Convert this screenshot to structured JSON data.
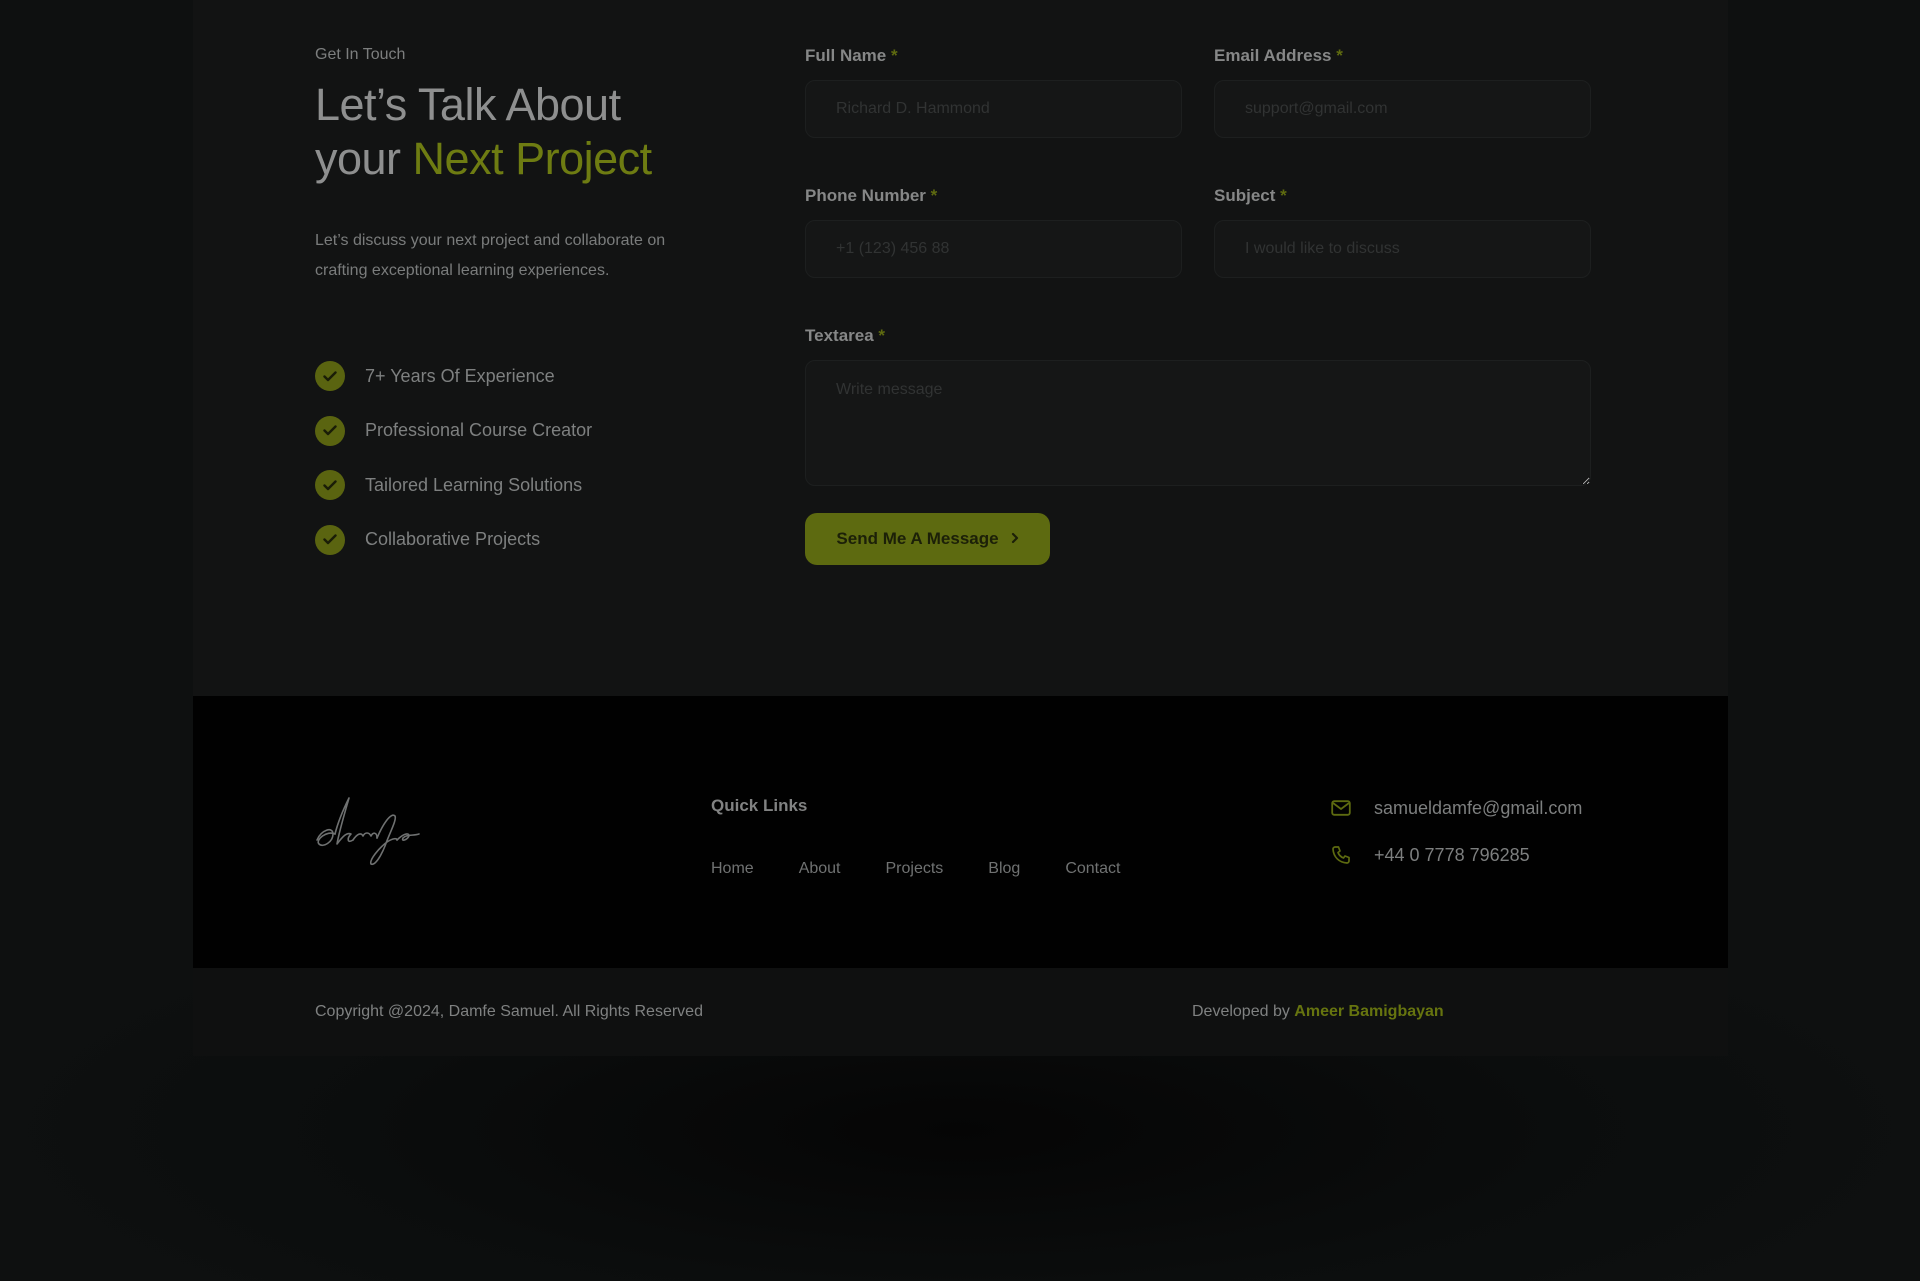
{
  "colors": {
    "accent": "#6e7c12",
    "button": "#5d6a10",
    "background": "#121313",
    "footer": "#010101"
  },
  "intro": {
    "eyebrow": "Get In Touch",
    "headline_line1": "Let’s Talk About",
    "headline_line2_plain": "your ",
    "headline_line2_accent": "Next Project",
    "lead": "Let’s discuss your next project and collaborate on crafting exceptional learning experiences.",
    "features": [
      {
        "icon": "check-circle-icon",
        "label": "7+ Years Of Experience"
      },
      {
        "icon": "check-circle-icon",
        "label": "Professional Course Creator"
      },
      {
        "icon": "check-circle-icon",
        "label": "Tailored Learning Solutions"
      },
      {
        "icon": "check-circle-icon",
        "label": "Collaborative Projects"
      }
    ]
  },
  "form": {
    "required_mark": "*",
    "full_name": {
      "label": "Full Name",
      "placeholder": "Richard D. Hammond"
    },
    "email": {
      "label": "Email Address",
      "placeholder": "support@gmail.com"
    },
    "phone": {
      "label": "Phone Number",
      "placeholder": "+1 (123) 456 88"
    },
    "subject": {
      "label": "Subject",
      "placeholder": "I would like to discuss"
    },
    "message": {
      "label": "Textarea",
      "placeholder": "Write message"
    },
    "submit_label": "Send Me A Message",
    "submit_icon": "chevron-right-icon"
  },
  "footer": {
    "logo_text": "damfe",
    "quick_links_title": "Quick Links",
    "links": [
      "Home",
      "About",
      "Projects",
      "Blog",
      "Contact"
    ],
    "email": {
      "icon": "mail-icon",
      "text": "samueldamfe@gmail.com"
    },
    "phone": {
      "icon": "phone-icon",
      "text": "+44 0 7778 796285"
    }
  },
  "bottom": {
    "copyright": "Copyright @2024, Damfe Samuel. All Rights Reserved",
    "developed_by_prefix": "Developed by ",
    "developer": "Ameer Bamigbayan"
  }
}
